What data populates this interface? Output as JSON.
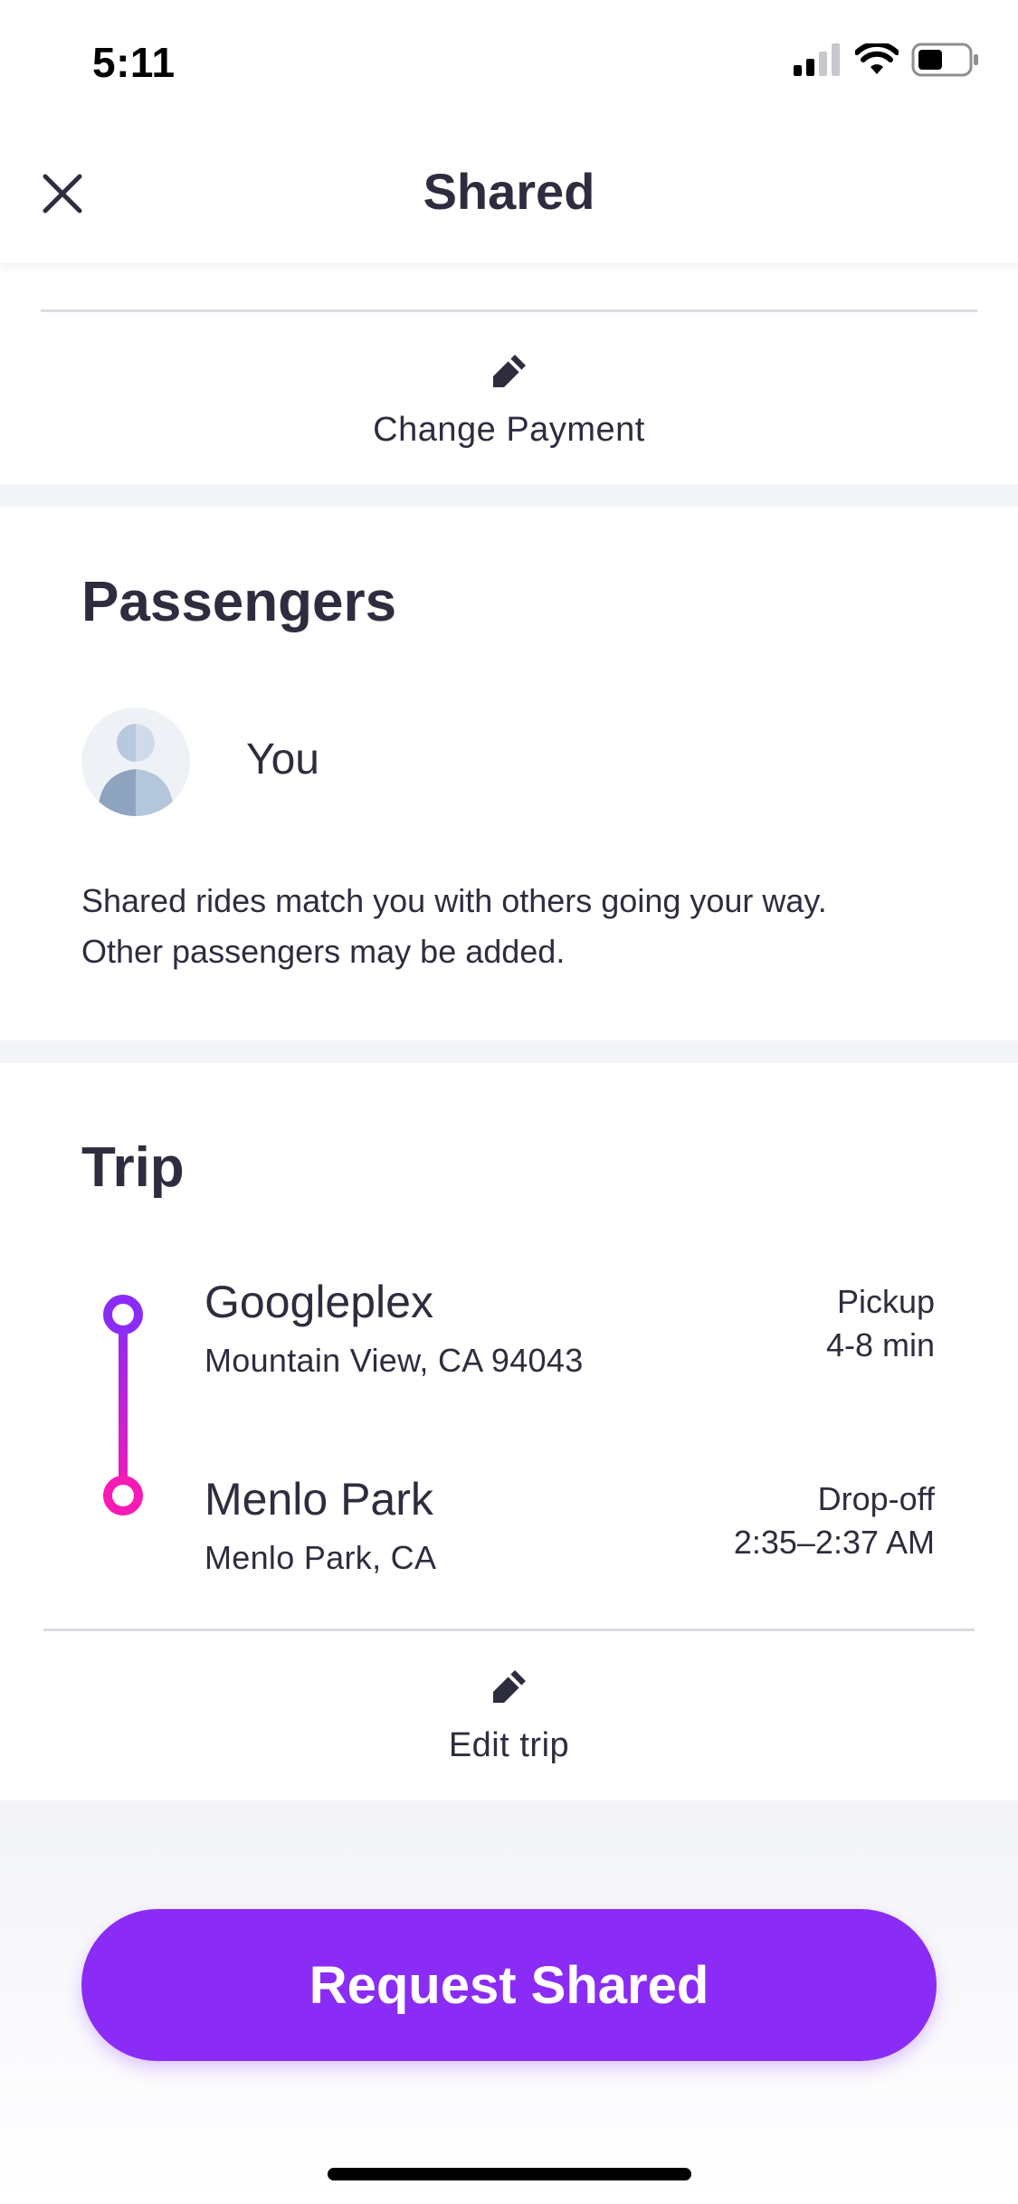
{
  "status_bar": {
    "time": "5:11",
    "signal_icon": "cellular-signal-icon",
    "wifi_icon": "wifi-icon",
    "battery_icon": "battery-icon"
  },
  "header": {
    "title": "Shared",
    "close_icon": "close-icon"
  },
  "payment": {
    "action_label": "Change Payment",
    "icon": "pencil-icon"
  },
  "passengers": {
    "heading": "Passengers",
    "list": [
      {
        "name": "You",
        "avatar_icon": "person-avatar-icon"
      }
    ],
    "note_line1": "Shared rides match you with others going your way.",
    "note_line2": "Other passengers may be added."
  },
  "trip": {
    "heading": "Trip",
    "stops": [
      {
        "name": "Googleplex",
        "address": "Mountain View, CA 94043",
        "type": "Pickup",
        "time": "4-8 min"
      },
      {
        "name": "Menlo Park",
        "address": "Menlo Park, CA",
        "type": "Drop-off",
        "time": "2:35–2:37 AM"
      }
    ],
    "edit_label": "Edit trip",
    "edit_icon": "pencil-icon"
  },
  "cta": {
    "label": "Request Shared"
  },
  "colors": {
    "accent": "#8a2cf5",
    "pickup": "#8a2cf5",
    "dropoff": "#f51bb4",
    "text": "#2e2d3f",
    "separator": "#f3f4f8"
  }
}
